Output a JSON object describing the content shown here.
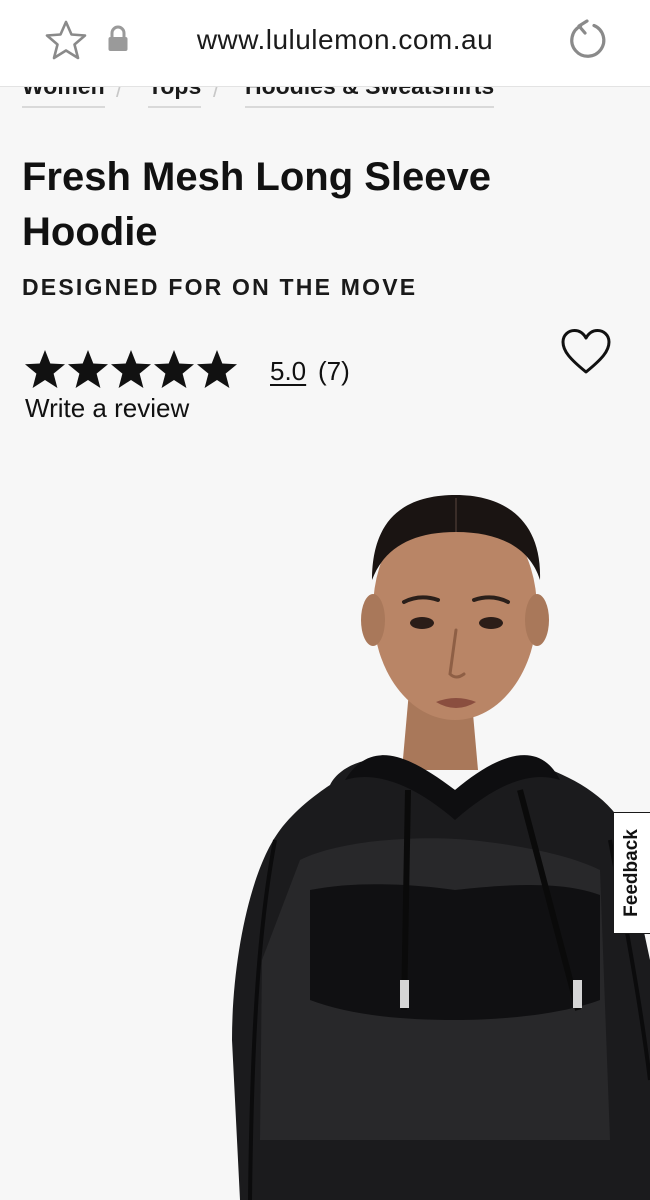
{
  "browser": {
    "url": "www.lululemon.com.au",
    "icons": [
      "star-icon",
      "lock-icon",
      "reload-icon"
    ]
  },
  "breadcrumb": {
    "items": [
      {
        "label": "Women"
      },
      {
        "label": "Tops"
      },
      {
        "label": "Hoodies & Sweatshirts"
      }
    ],
    "separator": "/"
  },
  "product": {
    "title": "Fresh Mesh Long Sleeve Hoodie",
    "subtitle": "DESIGNED FOR ON THE MOVE",
    "rating": {
      "value": "5.0",
      "count": "(7)",
      "stars_filled": 5,
      "stars_total": 5
    },
    "write_review": "Write a review",
    "wishlist_icon": "heart-outline-icon"
  },
  "feedback": {
    "label": "Feedback"
  },
  "colors": {
    "background": "#f7f7f7",
    "text": "#111111",
    "browser_bar": "#ffffff"
  }
}
